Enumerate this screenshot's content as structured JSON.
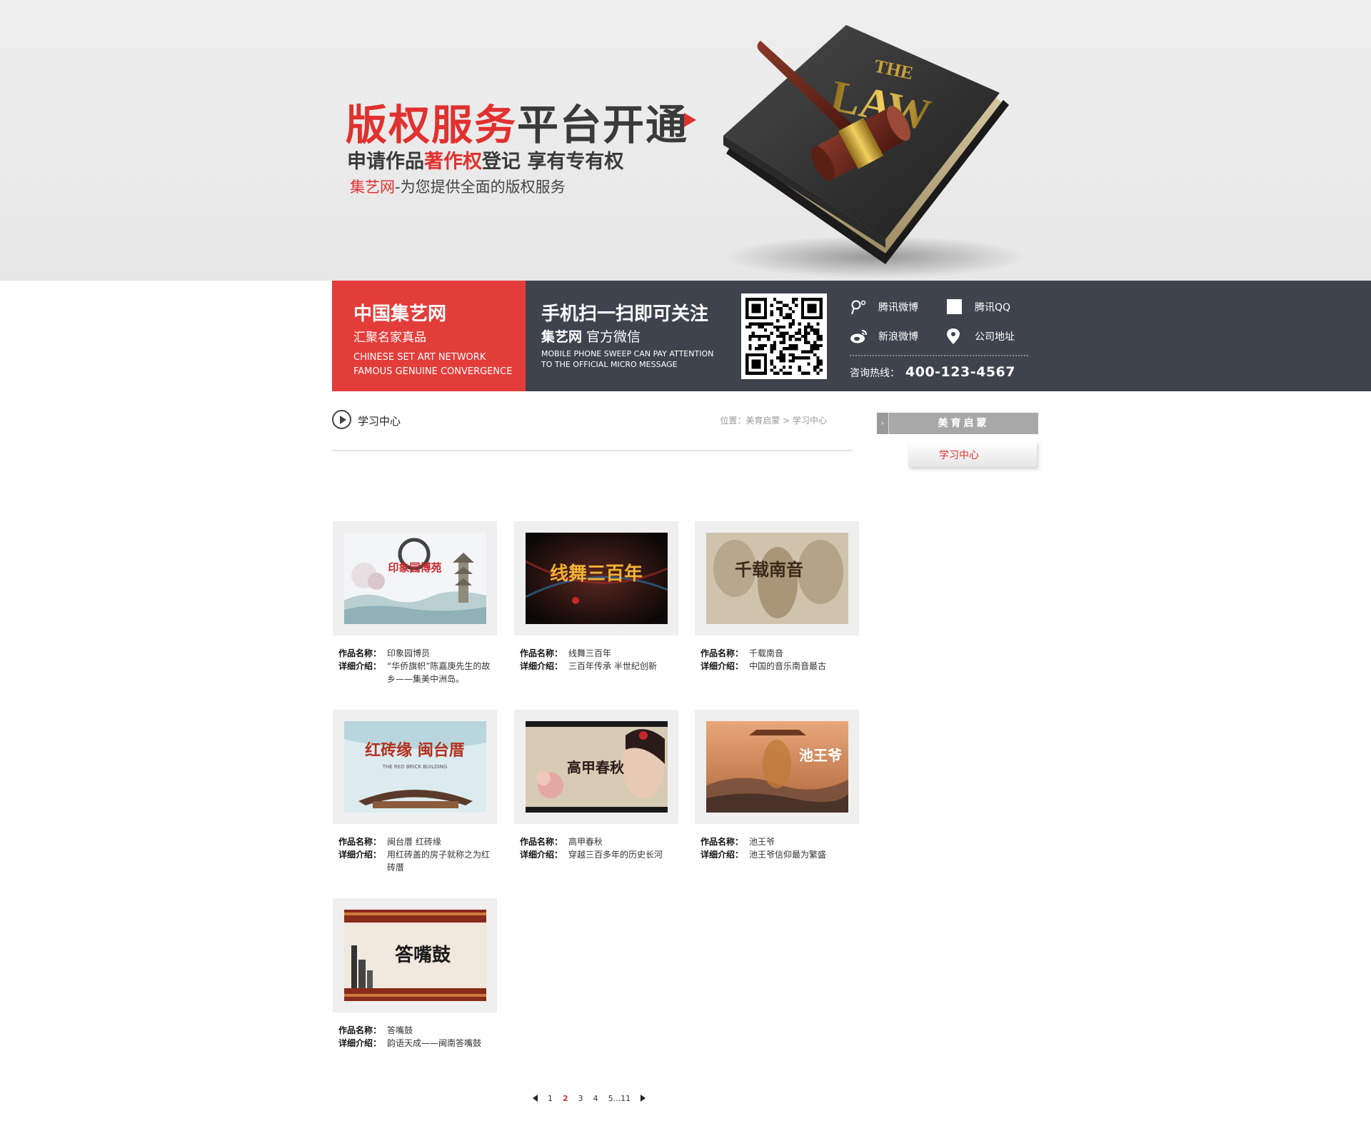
{
  "banner": {
    "headline_red": "版权服务",
    "headline_dark": "平台开通",
    "sub_a": "申请作品",
    "sub_red": "著作权",
    "sub_b": "登记 享有专有权",
    "line3_red": "集艺网",
    "line3_rest": "-为您提供全面的版权服务",
    "book_title_1": "THE",
    "book_title_2": "LAW"
  },
  "info": {
    "brand_title": "中国集艺网",
    "brand_sub": "汇聚名家真品",
    "brand_en_1": "CHINESE SET ART NETWORK",
    "brand_en_2": "FAMOUS GENUINE CONVERGENCE",
    "scan_title": "手机扫一扫即可关注",
    "scan_brand": "集艺网",
    "scan_rest": " 官方微信",
    "scan_en_1": "MOBILE PHONE SWEEP CAN PAY ATTENTION",
    "scan_en_2": "TO THE OFFICIAL MICRO MESSAGE",
    "links": {
      "tencent_weibo": "腾讯微博",
      "tencent_qq": "腾讯QQ",
      "sina_weibo": "新浪微博",
      "address": "公司地址"
    },
    "hotline_label": "咨询热线：",
    "hotline_number": "400-123-4567"
  },
  "section": {
    "title": "学习中心",
    "breadcrumb": "位置：美育启蒙 > 学习中心"
  },
  "sidebar": {
    "header": "美育启蒙",
    "arrow": "›",
    "item": "学习中心"
  },
  "labels": {
    "name": "作品名称：",
    "intro": "详细介绍："
  },
  "works": [
    {
      "name": "印象园博员",
      "intro": "“华侨旗帜”陈嘉庚先生的故乡——集美中洲岛。",
      "pic_text": "印象园博苑"
    },
    {
      "name": "线舞三百年",
      "intro": "三百年传承 半世纪创新",
      "pic_text": "线舞三百年"
    },
    {
      "name": "千载南音",
      "intro": "中国的音乐南音最古",
      "pic_text": "千载南音"
    },
    {
      "name": "闽台厝 红砖缘",
      "intro": "用红砖盖的房子就称之为红砖厝",
      "pic_text": "红砖缘 闽台厝",
      "pic_en": "THE RED BRICK BUILDING"
    },
    {
      "name": "高甲春秋",
      "intro": "穿越三百多年的历史长河",
      "pic_text": "高甲春秋"
    },
    {
      "name": "池王爷",
      "intro": "池王爷信仰最为繁盛",
      "pic_text": "池王爷"
    },
    {
      "name": "答嘴鼓",
      "intro": "韵语天成——闽南答嘴鼓",
      "pic_text": "答嘴鼓"
    }
  ],
  "pager": {
    "pages": [
      "1",
      "2",
      "3",
      "4",
      "5...11"
    ],
    "current": "2"
  },
  "colors": {
    "accent_red": "#e0312f",
    "info_bar": "#3f434e",
    "brand_box": "#e33d3a"
  }
}
